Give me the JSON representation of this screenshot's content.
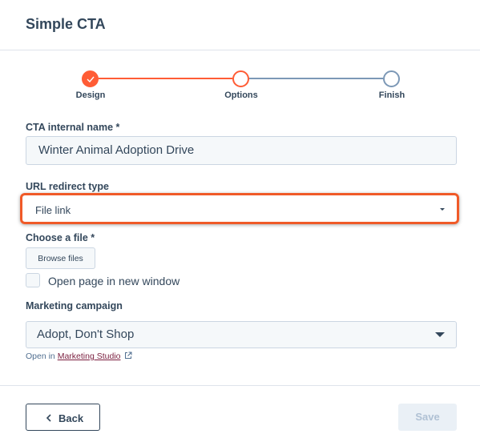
{
  "header": {
    "title": "Simple CTA"
  },
  "stepper": {
    "steps": [
      {
        "label": "Design",
        "state": "complete"
      },
      {
        "label": "Options",
        "state": "current"
      },
      {
        "label": "Finish",
        "state": "upcoming"
      }
    ],
    "colors": {
      "active": "#ff5c35",
      "inactive": "#7c98b6"
    }
  },
  "form": {
    "cta_name": {
      "label": "CTA internal name *",
      "value": "Winter Animal Adoption Drive"
    },
    "url_redirect": {
      "label": "URL redirect type",
      "value": "File link"
    },
    "choose_file": {
      "label": "Choose a file *",
      "button_label": "Browse files"
    },
    "open_new_window": {
      "label": "Open page in new window",
      "checked": false
    },
    "marketing_campaign": {
      "label": "Marketing campaign",
      "value": "Adopt, Don't Shop",
      "open_in_prefix": "Open in",
      "open_in_link": "Marketing Studio"
    }
  },
  "footer": {
    "back_label": "Back",
    "save_label": "Save"
  },
  "highlight_color": "#f05a28"
}
